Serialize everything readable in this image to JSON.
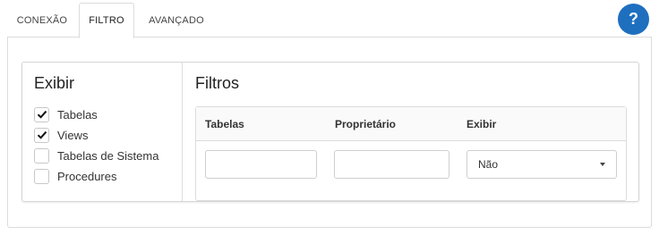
{
  "tabs": [
    {
      "label": "CONEXÃO",
      "active": false
    },
    {
      "label": "FILTRO",
      "active": true
    },
    {
      "label": "AVANÇADO",
      "active": false
    }
  ],
  "help": {
    "label": "?",
    "icon": "question-icon",
    "color": "#1f6fbf"
  },
  "exibir": {
    "title": "Exibir",
    "items": [
      {
        "label": "Tabelas",
        "checked": true
      },
      {
        "label": "Views",
        "checked": true
      },
      {
        "label": "Tabelas de Sistema",
        "checked": false
      },
      {
        "label": "Procedures",
        "checked": false
      }
    ]
  },
  "filtros": {
    "title": "Filtros",
    "columns": [
      "Tabelas",
      "Proprietário",
      "Exibir"
    ],
    "inputs": {
      "tabelas_value": "",
      "proprietario_value": ""
    },
    "exibir_select": {
      "selected": "Não"
    }
  }
}
